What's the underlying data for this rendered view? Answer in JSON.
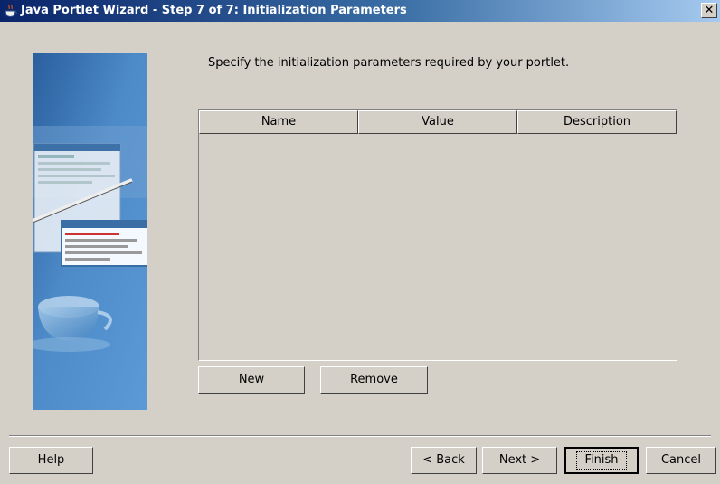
{
  "window": {
    "title": "Java Portlet Wizard - Step 7 of 7: Initialization Parameters",
    "close_label": "✕"
  },
  "instruction": "Specify the initialization parameters required by your portlet.",
  "table": {
    "columns": [
      "Name",
      "Value",
      "Description"
    ],
    "rows": []
  },
  "table_buttons": {
    "new_label": "New",
    "remove_label": "Remove"
  },
  "footer": {
    "help_label": "Help",
    "back_label": "< Back",
    "next_label": "Next >",
    "finish_label": "Finish",
    "cancel_label": "Cancel"
  },
  "icons": {
    "title": "coffee-cup-icon",
    "banner": "wizard-banner-graphic"
  },
  "colors": {
    "titlebar_start": "#0a246a",
    "titlebar_end": "#a6caf0",
    "dialog_bg": "#d4d0c8",
    "banner_blue": "#3a6ea5"
  }
}
